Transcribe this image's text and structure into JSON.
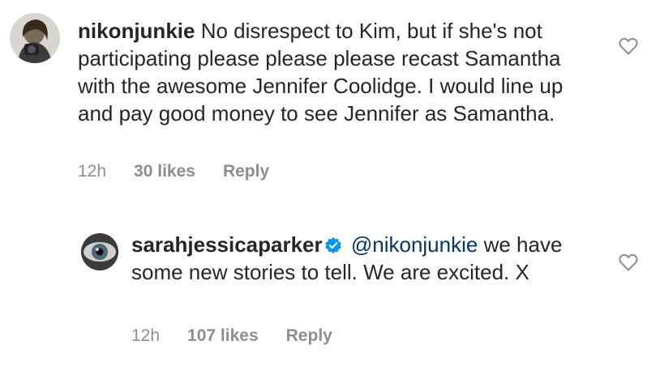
{
  "comments": [
    {
      "username": "nikonjunkie",
      "text": "No disrespect to Kim, but if she's not participating please please please recast Samantha with the awesome Jennifer Coolidge. I would line up and pay good money to see Jennifer as Samantha.",
      "time": "12h",
      "likes": "30 likes",
      "reply": "Reply",
      "icon": "heart-outline-icon"
    },
    {
      "username": "sarahjessicaparker",
      "verified": true,
      "mention": "@nikonjunkie",
      "text": "we have some new stories to tell. We are excited. X",
      "time": "12h",
      "likes": "107 likes",
      "reply": "Reply",
      "icon": "heart-outline-icon"
    }
  ],
  "colors": {
    "text": "#262626",
    "meta": "#8e8e8e",
    "mention": "#00376b",
    "verified": "#0095f6"
  }
}
